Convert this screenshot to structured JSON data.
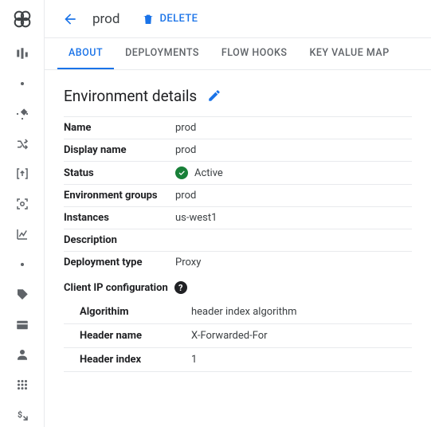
{
  "header": {
    "title": "prod",
    "delete_label": "DELETE"
  },
  "tabs": [
    {
      "label": "ABOUT",
      "active": true
    },
    {
      "label": "DEPLOYMENTS",
      "active": false
    },
    {
      "label": "FLOW HOOKS",
      "active": false
    },
    {
      "label": "KEY VALUE MAP",
      "active": false
    }
  ],
  "section": {
    "title": "Environment details"
  },
  "details": {
    "name_label": "Name",
    "name_value": "prod",
    "display_label": "Display name",
    "display_value": "prod",
    "status_label": "Status",
    "status_value": "Active",
    "envgroups_label": "Environment groups",
    "envgroups_value": "prod",
    "instances_label": "Instances",
    "instances_value": "us-west1",
    "description_label": "Description",
    "description_value": "",
    "deptype_label": "Deployment type",
    "deptype_value": "Proxy"
  },
  "clientip": {
    "title": "Client IP configuration",
    "algo_label": "Algorithim",
    "algo_value": "header index algorithm",
    "header_label": "Header name",
    "header_value": "X-Forwarded-For",
    "index_label": "Header index",
    "index_value": "1"
  }
}
